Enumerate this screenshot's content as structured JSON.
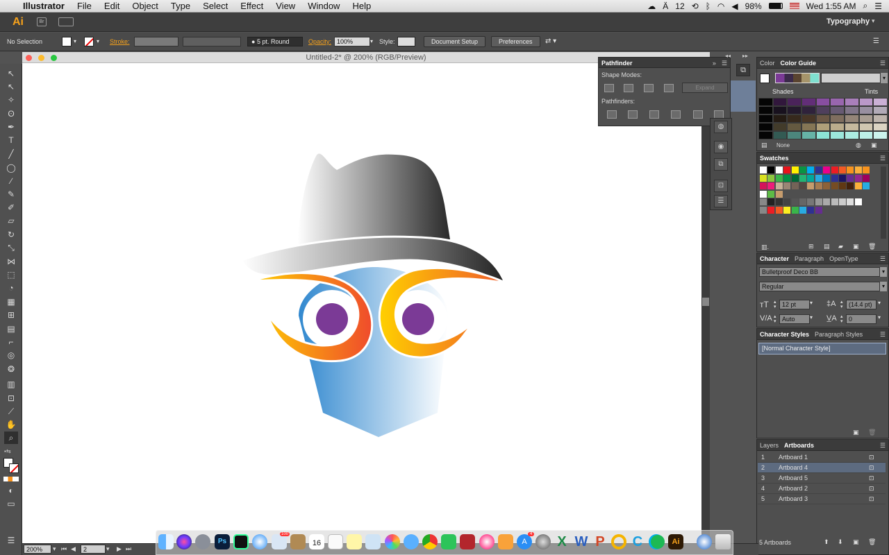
{
  "menubar": {
    "app": "Illustrator",
    "items": [
      "File",
      "Edit",
      "Object",
      "Type",
      "Select",
      "Effect",
      "View",
      "Window",
      "Help"
    ],
    "status_number": "12",
    "battery": "98%",
    "clock": "Wed 1:55 AM"
  },
  "appbar": {
    "logo": "Ai",
    "workspace": "Typography"
  },
  "control": {
    "selection": "No Selection",
    "stroke_label": "Stroke:",
    "brush": "5 pt. Round",
    "opacity_label": "Opacity:",
    "opacity": "100%",
    "style_label": "Style:",
    "doc_setup": "Document Setup",
    "preferences": "Preferences"
  },
  "document": {
    "title": "Untitled-2* @ 200% (RGB/Preview)"
  },
  "status": {
    "zoom": "200%",
    "artboard_num": "2"
  },
  "pathfinder": {
    "title": "Pathfinder",
    "shape_modes": "Shape Modes:",
    "expand": "Expand",
    "pathfinders": "Pathfinders:"
  },
  "color_panel": {
    "tabs": [
      "Color",
      "Color Guide"
    ],
    "shades": "Shades",
    "tints": "Tints",
    "none": "None"
  },
  "swatches": {
    "title": "Swatches"
  },
  "character": {
    "tabs": [
      "Character",
      "Paragraph",
      "OpenType"
    ],
    "font": "Bulletproof Deco BB",
    "style": "Regular",
    "size": "12 pt",
    "leading": "(14.4 pt)",
    "kerning": "Auto",
    "tracking": "0"
  },
  "char_styles": {
    "tabs": [
      "Character Styles",
      "Paragraph Styles"
    ],
    "item": "[Normal Character Style]"
  },
  "layers": {
    "tabs": [
      "Layers",
      "Artboards"
    ],
    "rows": [
      {
        "num": "1",
        "name": "Artboard 1"
      },
      {
        "num": "2",
        "name": "Artboard 4"
      },
      {
        "num": "3",
        "name": "Artboard 5"
      },
      {
        "num": "4",
        "name": "Artboard 2"
      },
      {
        "num": "5",
        "name": "Artboard 3"
      }
    ],
    "footer": "5 Artboards"
  },
  "dock": {
    "calendar_day": "16",
    "badge_mail": "100",
    "badge_appstore": "4",
    "apps": [
      "finder-icon",
      "siri-icon",
      "launchpad-icon",
      "photoshop-icon",
      "word-icon",
      "safari-icon",
      "mail-icon",
      "notes-icon",
      "calendar-icon",
      "reminders-icon",
      "stickies-icon",
      "preview-icon",
      "photos-icon",
      "messages-icon",
      "chrome-icon",
      "facetime-icon",
      "photo-booth-icon",
      "itunes-icon",
      "ibooks-icon",
      "app-store-icon",
      "system-preferences-icon",
      "excel-icon",
      "word-icon-2",
      "powerpoint-icon",
      "outlook-icon",
      "cortana-icon",
      "skype-icon",
      "spotify-icon",
      "illustrator-icon",
      "quicktime-icon",
      "trash-icon"
    ]
  },
  "colors": {
    "accent": "#f7931e",
    "purple": "#7b3a96",
    "blue": "#3f8fd2",
    "panel_bg": "#4f4f4f"
  }
}
